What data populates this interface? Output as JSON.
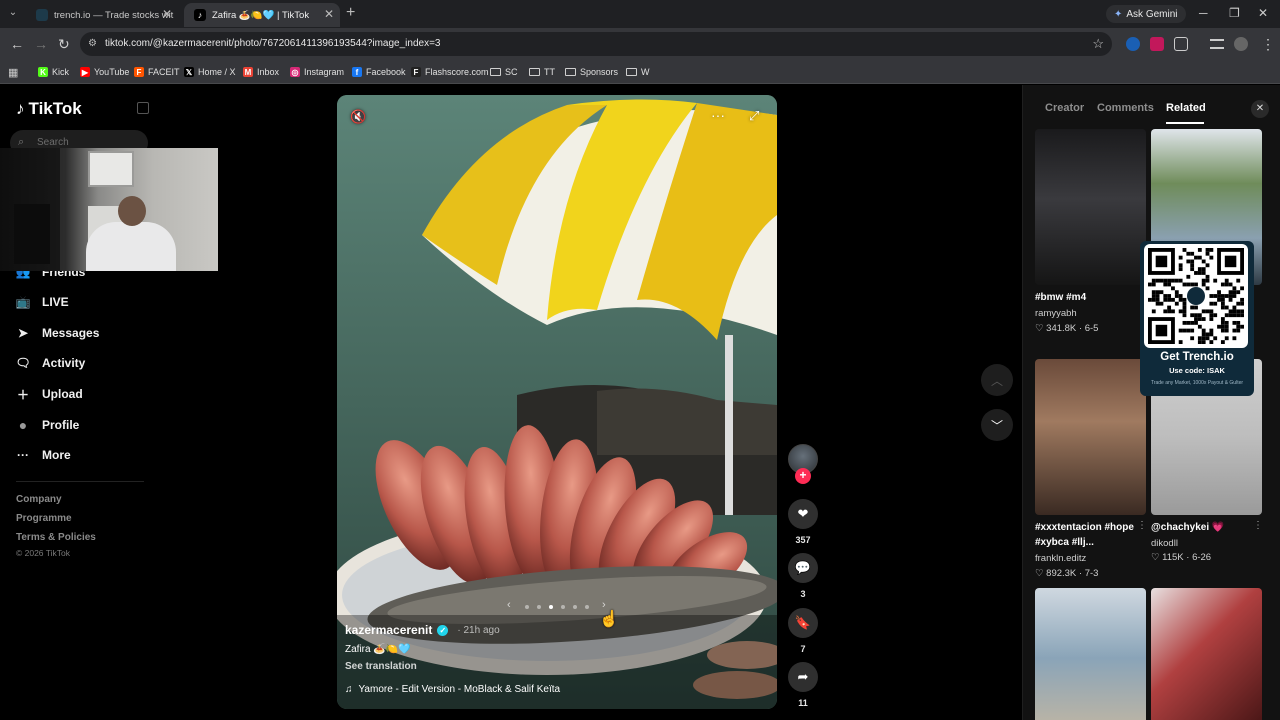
{
  "browser": {
    "tabs": [
      {
        "title": "trench.io — Trade stocks with a",
        "favicon_color": "#1d3a4a"
      },
      {
        "title": "Zafira 🍝🍋🩵 | TikTok",
        "favicon_color": "#000000"
      }
    ],
    "ask_gemini": "Ask Gemini",
    "url": "tiktok.com/@kazermacerenit/photo/7672061411396193544?image_index=3",
    "bookmarks": [
      {
        "label": "Kick",
        "color": "#53fc18",
        "glyph": "K"
      },
      {
        "label": "YouTube",
        "color": "#ff0000",
        "glyph": "▶"
      },
      {
        "label": "FACEIT",
        "color": "#ff5500",
        "glyph": "F"
      },
      {
        "label": "Home / X",
        "color": "#000000",
        "glyph": "𝕏"
      },
      {
        "label": "Inbox",
        "color": "#ea4335",
        "glyph": "M"
      },
      {
        "label": "Instagram",
        "color": "#d62976",
        "glyph": "◎"
      },
      {
        "label": "Facebook",
        "color": "#1877f2",
        "glyph": "f"
      },
      {
        "label": "Flashscore.com",
        "color": "#222222",
        "glyph": "F"
      },
      {
        "label": "SC",
        "folder": true
      },
      {
        "label": "TT",
        "folder": true
      },
      {
        "label": "Sponsors",
        "folder": true
      },
      {
        "label": "W",
        "folder": true
      }
    ]
  },
  "sidebar": {
    "logo": "TikTok",
    "search_placeholder": "Search",
    "items": [
      {
        "label": "Friends",
        "icon": "friends-icon",
        "glyph": "👥"
      },
      {
        "label": "LIVE",
        "icon": "live-icon",
        "glyph": "📺"
      },
      {
        "label": "Messages",
        "icon": "messages-icon",
        "glyph": "➤"
      },
      {
        "label": "Activity",
        "icon": "activity-icon",
        "glyph": "🗨"
      },
      {
        "label": "Upload",
        "icon": "upload-icon",
        "glyph": "＋"
      },
      {
        "label": "Profile",
        "icon": "profile-avatar",
        "glyph": "●"
      },
      {
        "label": "More",
        "icon": "more-icon",
        "glyph": "···"
      }
    ],
    "footer_links": [
      "Company",
      "Programme",
      "Terms & Policies"
    ],
    "copyright": "© 2026 TikTok"
  },
  "post": {
    "author": "kazermacerenit",
    "time_ago": "21h ago",
    "caption": "Zafira 🍝🍋🩵",
    "see_translation": "See translation",
    "music": "Yamore - Edit Version - MoBlack & Salif Keïta",
    "slide_count": 6,
    "active_slide": 3
  },
  "actions": {
    "likes": "357",
    "comments": "3",
    "saves": "7",
    "shares": "11"
  },
  "right_panel": {
    "tabs": [
      "Creator",
      "Comments",
      "Related"
    ],
    "active_tab": "Related",
    "videos": [
      {
        "title": "#bmw #m4",
        "author": "ramyyabh",
        "stats": "341.8K · 6-5",
        "bg": "linear-gradient(180deg,#1a1a1c 0%,#3a3a3e 45%,#151515 100%)"
      },
      {
        "title": "",
        "author": "",
        "stats": "",
        "bg": "linear-gradient(180deg,#dfe5ea 0%,#6f8c5a 35%,#8aa0b0 70%,#2e3a44 100%)"
      },
      {
        "title": "#xxxtentacion #hope #xybca #llj...",
        "author": "frankln.editz",
        "stats": "892.3K · 7-3",
        "bg": "linear-gradient(180deg,#6a4a3a 0%,#a07a60 40%,#3a2a22 100%)"
      },
      {
        "title": "@chachykei 💗",
        "author": "dikodll",
        "stats": "115K · 6-26",
        "bg": "linear-gradient(180deg,#cfcfcf 0%,#bdbdbd 50%,#9a9a9a 100%)"
      },
      {
        "title": "",
        "author": "",
        "stats": "",
        "bg": "linear-gradient(180deg,#cfd8e0 0%,#8aa4b8 45%,#c9b9a0 100%)"
      },
      {
        "title": "",
        "author": "",
        "stats": "",
        "bg": "linear-gradient(135deg,#e8e0e0 0%,#b04040 40%,#3a1010 100%)"
      }
    ]
  },
  "qr_ad": {
    "title": "Get Trench.io",
    "code": "Use code: ISAK",
    "subtitle": "Trade any Market, 1000x Payout & Gulter"
  }
}
